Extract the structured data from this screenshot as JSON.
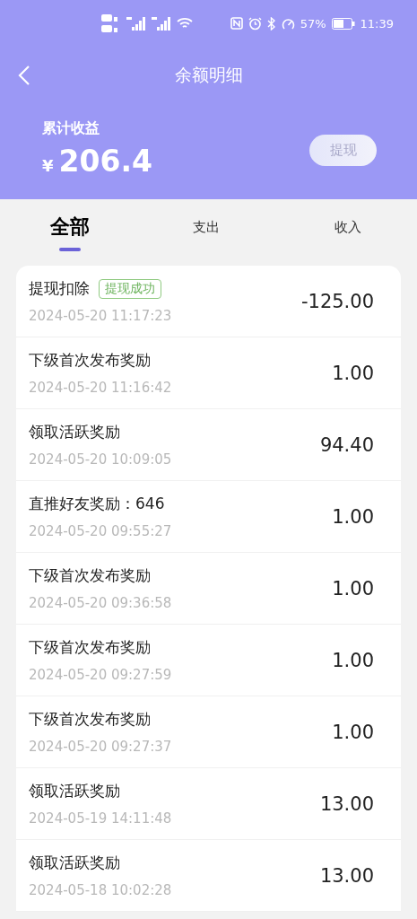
{
  "status_bar": {
    "battery_percent": "57%",
    "time": "11:39"
  },
  "nav": {
    "title": "余额明细"
  },
  "summary": {
    "label": "累计收益",
    "currency": "¥",
    "amount": "206.4",
    "button": "提现"
  },
  "tabs": [
    {
      "label": "全部",
      "selected": true
    },
    {
      "label": "支出",
      "selected": false
    },
    {
      "label": "收入",
      "selected": false
    }
  ],
  "records": [
    {
      "title": "提现扣除",
      "badge": "提现成功",
      "time": "2024-05-20 11:17:23",
      "amount": "-125.00"
    },
    {
      "title": "下级首次发布奖励",
      "time": "2024-05-20 11:16:42",
      "amount": "1.00"
    },
    {
      "title": "领取活跃奖励",
      "time": "2024-05-20 10:09:05",
      "amount": "94.40"
    },
    {
      "title": "直推好友奖励：646",
      "time": "2024-05-20 09:55:27",
      "amount": "1.00"
    },
    {
      "title": "下级首次发布奖励",
      "time": "2024-05-20 09:36:58",
      "amount": "1.00"
    },
    {
      "title": "下级首次发布奖励",
      "time": "2024-05-20 09:27:59",
      "amount": "1.00"
    },
    {
      "title": "下级首次发布奖励",
      "time": "2024-05-20 09:27:37",
      "amount": "1.00"
    },
    {
      "title": "领取活跃奖励",
      "time": "2024-05-19 14:11:48",
      "amount": "13.00"
    },
    {
      "title": "领取活跃奖励",
      "time": "2024-05-18 10:02:28",
      "amount": "13.00"
    }
  ]
}
